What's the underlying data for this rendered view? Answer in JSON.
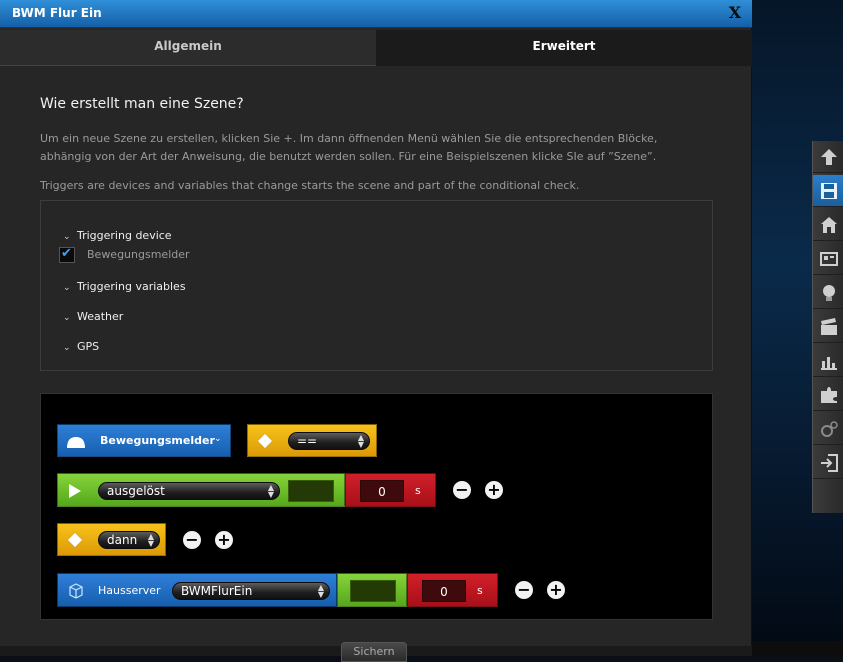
{
  "window": {
    "title": "BWM Flur Ein",
    "close_label": "X"
  },
  "tabs": [
    {
      "label": "Allgemein",
      "active": false
    },
    {
      "label": "Erweitert",
      "active": true
    }
  ],
  "help": {
    "heading": "Wie erstellt man eine Szene?",
    "paragraph_line1": "Um ein neue Szene zu erstellen, klicken Sie +. Im dann öffnenden Menü wählen Sie die entsprechenden Blöcke,",
    "paragraph_line2": "abhängig von der Art der Anweisung, die benutzt werden sollen. Für eine Beispielszenen klicke SIe auf ”Szene”.",
    "triggers_note": "Triggers are devices and variables that change starts the scene and part of the conditional check."
  },
  "triggers": {
    "sections": [
      {
        "label": "Triggering device"
      },
      {
        "label": "Triggering variables"
      },
      {
        "label": "Weather"
      },
      {
        "label": "GPS"
      }
    ],
    "device_item": {
      "label": "Bewegungsmelder",
      "checked": true
    }
  },
  "scene": {
    "row1": {
      "device_label": "Bewegungsmelder",
      "operator": "=="
    },
    "row2": {
      "state": "ausgelöst",
      "delay_value": "0",
      "delay_unit": "s"
    },
    "row3": {
      "then_label": "dann"
    },
    "row4": {
      "device_label": "Hausserver",
      "target": "BWMFlurEin",
      "delay_value": "0",
      "delay_unit": "s"
    },
    "minus_symbol": "−",
    "plus_symbol": "+"
  },
  "footer": {
    "save_label": "Sichern"
  },
  "colors": {
    "titlebar": "#1f73c0",
    "blue_block": "#1f6ec4",
    "yellow_block": "#f0b312",
    "green_block": "#6cbf2b",
    "red_block": "#c0181f"
  }
}
